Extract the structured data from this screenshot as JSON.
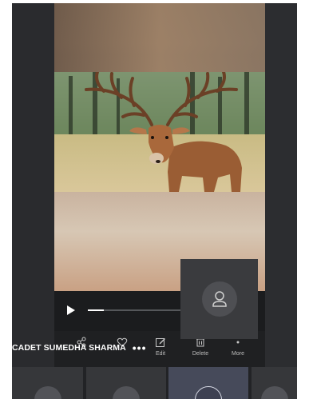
{
  "video": {
    "progress_fraction": 0.1
  },
  "actions": [
    {
      "label": "",
      "icon": "share-icon"
    },
    {
      "label": "",
      "icon": "heart-icon"
    },
    {
      "label": "Edit",
      "icon": "edit-icon"
    },
    {
      "label": "Delete",
      "icon": "trash-icon"
    },
    {
      "label": "More",
      "icon": "more-icon"
    }
  ],
  "participant": {
    "name": "CADET SUMEDHA SHARMA",
    "options": "•••",
    "avatar_icon": "person-icon"
  },
  "colors": {
    "background": "#222326",
    "active_tile": "#464a5a",
    "card": "#3a3b3e"
  }
}
